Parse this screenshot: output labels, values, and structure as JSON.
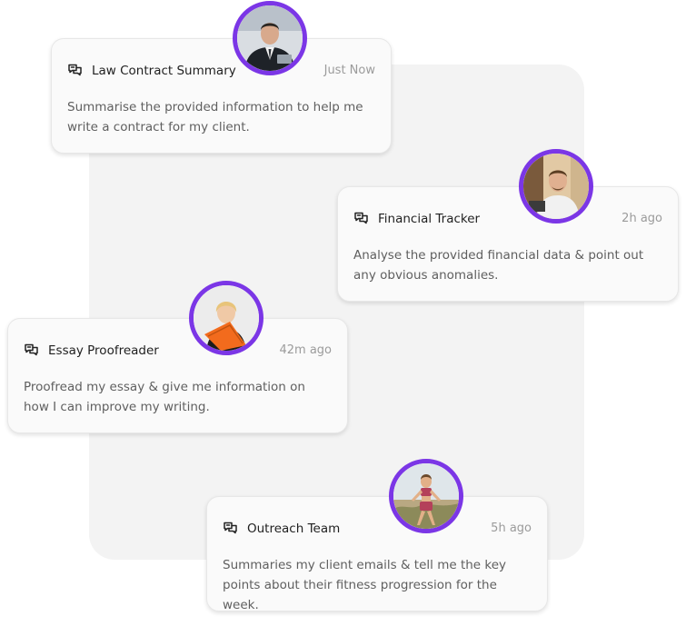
{
  "cards": [
    {
      "title": "Law Contract Summary",
      "time": "Just Now",
      "body": "Summarise the provided information to help me write a contract for my client."
    },
    {
      "title": "Financial Tracker",
      "time": "2h ago",
      "body": "Analyse the provided financial data & point out any obvious anomalies."
    },
    {
      "title": "Essay Proofreader",
      "time": "42m ago",
      "body": "Proofread my essay & give me information on how I can improve my writing."
    },
    {
      "title": "Outreach Team",
      "time": "5h ago",
      "body": "Summaries my client emails & tell me the key points about their fitness progression for the week."
    }
  ],
  "colors": {
    "avatar_ring": "#7b36e6",
    "card_background": "#fafafa",
    "backdrop": "#f3f3f3"
  },
  "icons": {
    "card_icon": "chat-bubbles-icon"
  }
}
